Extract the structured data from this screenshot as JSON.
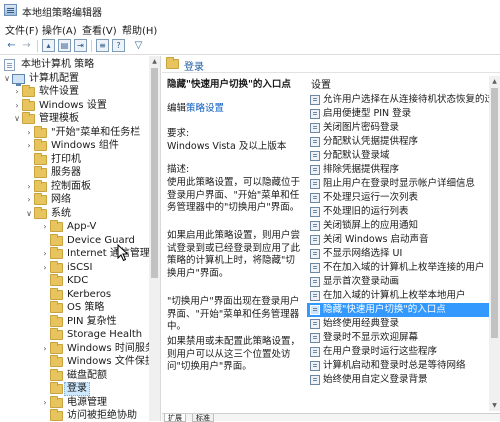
{
  "window": {
    "title": "本地组策略编辑器"
  },
  "menu": [
    "文件(F)",
    "操作(A)",
    "查看(V)",
    "帮助(H)"
  ],
  "toolbar": {
    "icons": [
      "back-arrow-icon",
      "forward-arrow-icon",
      "folder-up-icon",
      "show-hide-tree-icon",
      "export-list-icon",
      "properties-icon",
      "help-icon",
      "filter-icon"
    ]
  },
  "tree": {
    "items": [
      {
        "label": "本地计算机 策略",
        "icon": "computer-icon",
        "expand": "",
        "level": 0
      },
      {
        "label": "计算机配置",
        "icon": "computer-icon",
        "expand": "open",
        "level": 1
      },
      {
        "label": "软件设置",
        "icon": "folder-icon",
        "expand": "closed",
        "level": 2
      },
      {
        "label": "Windows 设置",
        "icon": "folder-icon",
        "expand": "closed",
        "level": 2
      },
      {
        "label": "管理模板",
        "icon": "folder-icon",
        "expand": "open",
        "level": 2
      },
      {
        "label": "\"开始\"菜单和任务栏",
        "icon": "folder-icon",
        "expand": "closed",
        "level": 3
      },
      {
        "label": "Windows 组件",
        "icon": "folder-icon",
        "expand": "closed",
        "level": 3
      },
      {
        "label": "打印机",
        "icon": "folder-icon",
        "expand": "",
        "level": 3
      },
      {
        "label": "服务器",
        "icon": "folder-icon",
        "expand": "",
        "level": 3
      },
      {
        "label": "控制面板",
        "icon": "folder-icon",
        "expand": "closed",
        "level": 3
      },
      {
        "label": "网络",
        "icon": "folder-icon",
        "expand": "closed",
        "level": 3
      },
      {
        "label": "系统",
        "icon": "folder-icon",
        "expand": "open",
        "level": 3
      },
      {
        "label": "App-V",
        "icon": "folder-icon",
        "expand": "closed",
        "level": 4
      },
      {
        "label": "Device Guard",
        "icon": "folder-icon",
        "expand": "",
        "level": 4
      },
      {
        "label": "Internet 通信管理",
        "icon": "folder-icon",
        "expand": "closed",
        "level": 4
      },
      {
        "label": "iSCSI",
        "icon": "folder-icon",
        "expand": "closed",
        "level": 4
      },
      {
        "label": "KDC",
        "icon": "folder-icon",
        "expand": "",
        "level": 4
      },
      {
        "label": "Kerberos",
        "icon": "folder-icon",
        "expand": "",
        "level": 4
      },
      {
        "label": "OS 策略",
        "icon": "folder-icon",
        "expand": "",
        "level": 4
      },
      {
        "label": "PIN 复杂性",
        "icon": "folder-icon",
        "expand": "",
        "level": 4
      },
      {
        "label": "Storage Health",
        "icon": "folder-icon",
        "expand": "",
        "level": 4
      },
      {
        "label": "Windows 时间服务",
        "icon": "folder-icon",
        "expand": "closed",
        "level": 4
      },
      {
        "label": "Windows 文件保护",
        "icon": "folder-icon",
        "expand": "",
        "level": 4
      },
      {
        "label": "磁盘配额",
        "icon": "folder-icon",
        "expand": "",
        "level": 4
      },
      {
        "label": "登录",
        "icon": "folder-icon",
        "expand": "",
        "level": 4,
        "selected": true
      },
      {
        "label": "电源管理",
        "icon": "folder-icon",
        "expand": "closed",
        "level": 4
      },
      {
        "label": "访问被拒绝协助",
        "icon": "folder-icon",
        "expand": "",
        "level": 4
      }
    ]
  },
  "detail": {
    "header": "登录",
    "policy_title": "隐藏\"快速用户切换\"的入口点",
    "edit_prefix": "编辑",
    "edit_link": "策略设置",
    "req_label": "要求:",
    "req_value": "Windows Vista 及以上版本",
    "desc_label": "描述:",
    "desc_1": "使用此策略设置，可以隐藏位于登录用户界面、\"开始\"菜单和任务管理器中的\"切换用户\"界面。",
    "desc_2": "如果启用此策略设置，则用户尝试登录到或已经登录到应用了此策略的计算机上时，将隐藏\"切换用户\"界面。",
    "desc_3": "\"切换用户\"界面出现在登录用户界面、\"开始\"菜单和任务管理器中。",
    "desc_4": "如果禁用或未配置此策略设置，则用户可以从这三个位置处访问\"切换用户\"界面。"
  },
  "settings": {
    "header": "设置",
    "items": [
      "允许用户选择在从连接待机状态恢复的过程中何时要求输入密码",
      "启用便捷型 PIN 登录",
      "关闭图片密码登录",
      "分配默认凭据提供程序",
      "分配默认登录域",
      "排除凭据提供程序",
      "阻止用户在登录时显示帐户详细信息",
      "不处理只运行一次列表",
      "不处理旧的运行列表",
      "关闭锁屏上的应用通知",
      "关闭 Windows 启动声音",
      "不显示网络选择 UI",
      "不在加入域的计算机上枚举连接的用户",
      "显示首次登录动画",
      "在加入域的计算机上枚举本地用户",
      "隐藏\"快速用户切换\"的入口点",
      "始终使用经典登录",
      "登录时不显示欢迎屏幕",
      "在用户登录时运行这些程序",
      "计算机启动和登录时总是等待网络",
      "始终使用自定义登录背景"
    ],
    "selected_index": 15
  },
  "tabs": [
    "扩展",
    "标准"
  ],
  "colors": {
    "selection": "#3399ff",
    "tree_selection": "#cde8ff",
    "link": "#0b5cc0"
  }
}
